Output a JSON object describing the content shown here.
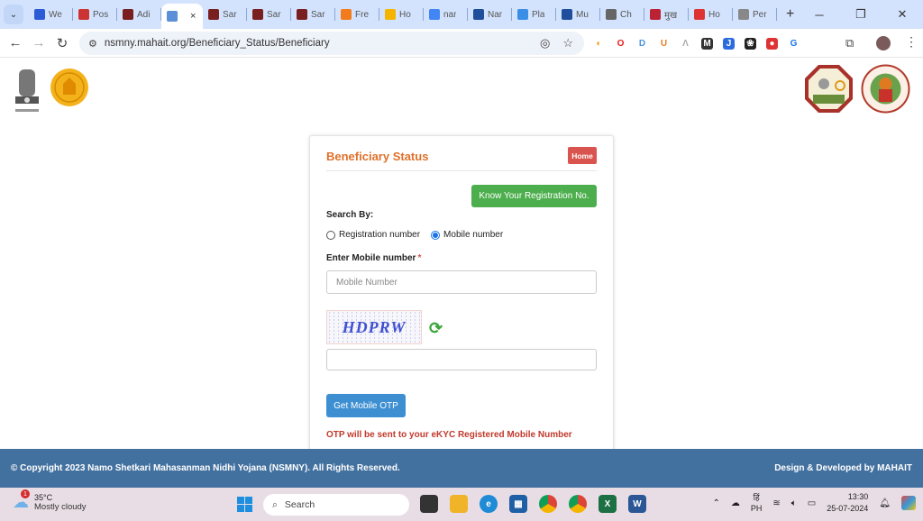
{
  "browser": {
    "tabs": [
      {
        "label": "We",
        "icon": "h-icon",
        "color": "#2c5bd6"
      },
      {
        "label": "Pos",
        "icon": "doc-icon",
        "color": "#c33"
      },
      {
        "label": "Adi",
        "icon": "maha-icon",
        "color": "#7a1f1f"
      },
      {
        "label": "",
        "icon": "page-icon",
        "color": "#5b8fd6",
        "active": true
      },
      {
        "label": "Sar",
        "icon": "maha-icon",
        "color": "#7a1f1f"
      },
      {
        "label": "Sar",
        "icon": "maha-icon",
        "color": "#7a1f1f"
      },
      {
        "label": "Sar",
        "icon": "maha-icon",
        "color": "#7a1f1f"
      },
      {
        "label": "Fre",
        "icon": "a-icon",
        "color": "#f27b1c"
      },
      {
        "label": "Ho",
        "icon": "ads-icon",
        "color": "#f4b400"
      },
      {
        "label": "nar",
        "icon": "google-icon",
        "color": "#4285f4"
      },
      {
        "label": "Nar",
        "icon": "u-icon",
        "color": "#1e4e9c"
      },
      {
        "label": "Pla",
        "icon": "c-icon",
        "color": "#3a8ee6"
      },
      {
        "label": "Mu",
        "icon": "u-icon",
        "color": "#1e4e9c"
      },
      {
        "label": "Ch",
        "icon": "openai-icon",
        "color": "#666"
      },
      {
        "label": "मुख",
        "icon": "maha-icon",
        "color": "#b23"
      },
      {
        "label": "Ho",
        "icon": "target-icon",
        "color": "#d33"
      },
      {
        "label": "Per",
        "icon": "emblem-icon",
        "color": "#888"
      }
    ],
    "active_tab_close": "×",
    "new_tab": "+",
    "url_site_icon": "⚙",
    "url": "nsmny.mahait.org/Beneficiary_Status/Beneficiary",
    "extensions": [
      {
        "name": "ext-swirl",
        "glyph": "◐",
        "color": "#f39c12",
        "bg": "#fff"
      },
      {
        "name": "ext-opera",
        "glyph": "O",
        "color": "#e41b1b",
        "bg": "#fff"
      },
      {
        "name": "ext-d",
        "glyph": "D",
        "color": "#4a90e2",
        "bg": "#fff"
      },
      {
        "name": "ext-u",
        "glyph": "U",
        "color": "#e67e22",
        "bg": "#fff"
      },
      {
        "name": "ext-a",
        "glyph": "Λ",
        "color": "#aaa",
        "bg": "#fff"
      },
      {
        "name": "ext-m",
        "glyph": "M",
        "color": "#fff",
        "bg": "#333"
      },
      {
        "name": "ext-j",
        "glyph": "J",
        "color": "#fff",
        "bg": "#2d6cdf"
      },
      {
        "name": "ext-dark",
        "glyph": "❀",
        "color": "#fff",
        "bg": "#222"
      },
      {
        "name": "ext-rec",
        "glyph": "●",
        "color": "#fff",
        "bg": "#d33"
      },
      {
        "name": "ext-g",
        "glyph": "G",
        "color": "#1a73e8",
        "bg": "#fff"
      }
    ]
  },
  "page": {
    "card": {
      "title": "Beneficiary Status",
      "home_label": "Home",
      "know_reg_label": "Know Your Registration No.",
      "search_by_label": "Search By:",
      "radio_options": [
        {
          "label": "Registration number",
          "checked": false
        },
        {
          "label": "Mobile number",
          "checked": true
        }
      ],
      "mobile_label": "Enter Mobile number",
      "required_mark": "*",
      "mobile_placeholder": "Mobile Number",
      "mobile_value": "",
      "captcha_text": "HDPRW",
      "captcha_value": "",
      "get_otp_label": "Get Mobile OTP",
      "otp_note": "OTP will be sent to your eKYC Registered Mobile Number"
    },
    "footer": {
      "copyright": "© Copyright 2023 Namo Shetkari Mahasanman Nidhi Yojana (NSMNY). All Rights Reserved.",
      "developer": "Design & Developed by MAHAIT"
    }
  },
  "taskbar": {
    "weather_badge": "1",
    "temperature": "35°C",
    "weather_desc": "Mostly cloudy",
    "search_label": "Search",
    "ime_top": "हिं",
    "ime_bottom": "PH",
    "time": "13:30",
    "date": "25-07-2024"
  }
}
